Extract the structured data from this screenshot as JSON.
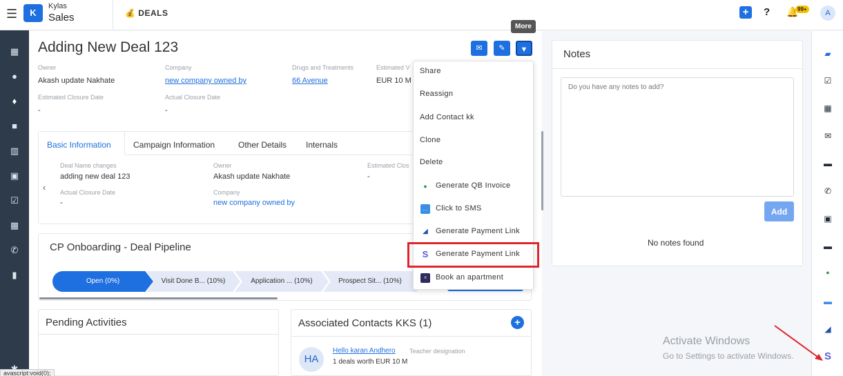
{
  "topbar": {
    "brand_line1": "Kylas",
    "brand_line2": "Sales",
    "logo_text": "K",
    "module": "DEALS",
    "help": "?",
    "notif_badge": "99+",
    "avatar": "A"
  },
  "deal": {
    "title": "Adding New Deal 123",
    "fields": [
      {
        "label": "Owner",
        "value": "Akash update Nakhate"
      },
      {
        "label": "Company",
        "value": "new company owned by"
      },
      {
        "label": "Drugs and Treatments",
        "value": "66 Avenue"
      },
      {
        "label": "Estimated V",
        "value": "EUR 10 M"
      },
      {
        "label": "Estimated Closure Date",
        "value": "-"
      },
      {
        "label": "Actual Closure Date",
        "value": "-"
      }
    ]
  },
  "tooltip_more": "More",
  "tabs": [
    "Basic Information",
    "Campaign Information",
    "Other Details",
    "Internals"
  ],
  "basic_info": [
    {
      "label": "Deal Name changes",
      "value": "adding new deal 123"
    },
    {
      "label": "Owner",
      "value": "Akash update Nakhate"
    },
    {
      "label": "Estimated Clos",
      "value": "-"
    },
    {
      "label": "Actual Closure Date",
      "value": "-"
    },
    {
      "label": "Company",
      "value": "new company owned by"
    }
  ],
  "pipeline": {
    "title": "CP Onboarding - Deal Pipeline",
    "stages": [
      "Open (0%)",
      "Visit Done B... (10%)",
      "Application ... (10%)",
      "Prospect Sit... (10%)"
    ]
  },
  "pending": {
    "title": "Pending Activities"
  },
  "contacts": {
    "title": "Associated Contacts KKS (1)",
    "items": [
      {
        "initials": "HA",
        "name": "Hello karan Andhero",
        "designation": "Teacher designation",
        "deals": "1 deals worth EUR 10 M"
      }
    ]
  },
  "notes": {
    "title": "Notes",
    "placeholder": "Do you have any notes to add?",
    "add_label": "Add",
    "empty": "No notes found"
  },
  "menu": {
    "items": [
      {
        "label": "Share",
        "icon": ""
      },
      {
        "label": "Reassign",
        "icon": ""
      },
      {
        "label": "Add Contact kk",
        "icon": ""
      },
      {
        "label": "Clone",
        "icon": ""
      },
      {
        "label": "Delete",
        "icon": ""
      },
      {
        "label": "Generate QB Invoice",
        "icon": "qb-invoice-icon"
      },
      {
        "label": "Click to SMS",
        "icon": "sms-icon"
      },
      {
        "label": "Generate Payment Link",
        "icon": "payment-link-icon"
      },
      {
        "label": "Generate Payment Link",
        "icon": "stripe-icon"
      },
      {
        "label": "Book an apartment",
        "icon": "apartment-icon"
      }
    ]
  },
  "watermark": {
    "line1": "Activate Windows",
    "line2": "Go to Settings to activate Windows."
  },
  "status_bar_text": "avascript:void(0);",
  "colors": {
    "accent": "#1e6fe0",
    "highlight": "#e0242b",
    "sidebar": "#2d3b4a"
  }
}
